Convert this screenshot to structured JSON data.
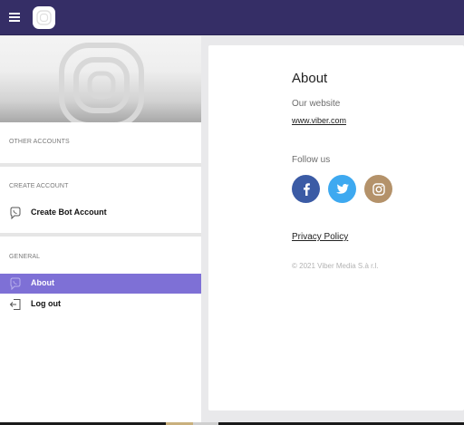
{
  "sidebar": {
    "sections": {
      "other_accounts": "OTHER ACCOUNTS",
      "create_account": "CREATE ACCOUNT",
      "general": "GENERAL"
    },
    "items": {
      "create_bot": "Create Bot Account",
      "about": "About",
      "logout": "Log out"
    }
  },
  "about": {
    "title": "About",
    "website_label": "Our website",
    "website_link": "www.viber.com",
    "follow_label": "Follow us",
    "privacy_link": "Privacy Policy",
    "copyright": "© 2021 Viber Media S.à r.l."
  },
  "social": {
    "facebook_color": "#3b5ba5",
    "twitter_color": "#3ea9f0",
    "instagram_color": "#b4926a"
  },
  "colors": {
    "topbar": "#352e66",
    "active_item": "#7e70d6"
  }
}
